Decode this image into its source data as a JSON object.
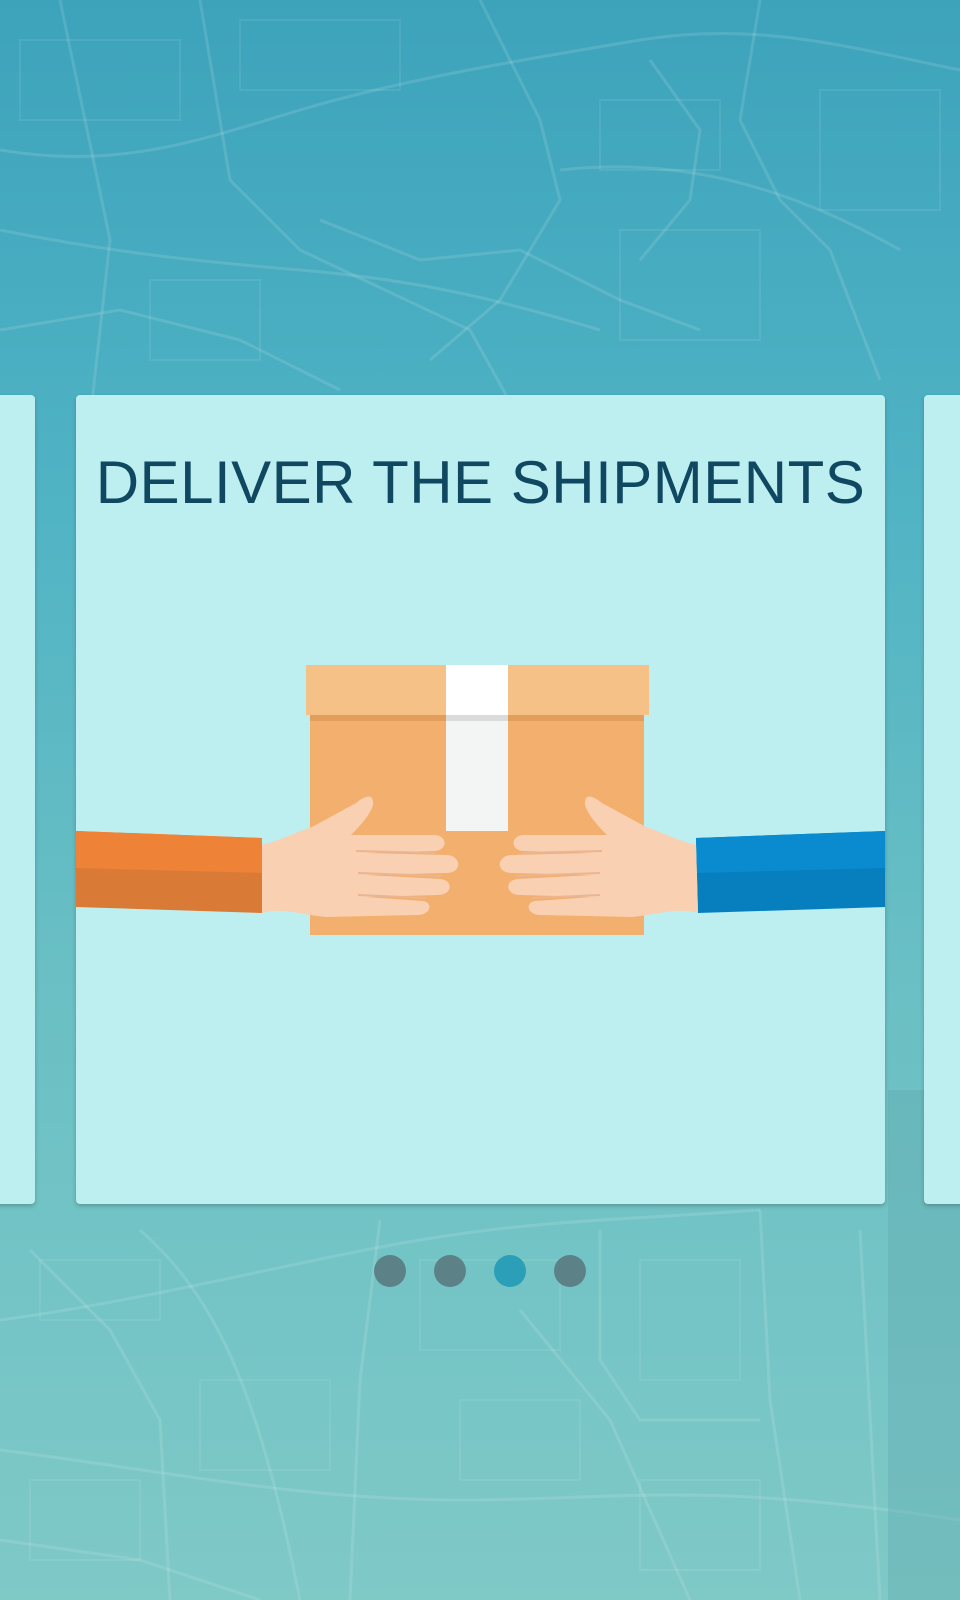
{
  "onboarding": {
    "title": "DELIVER THE SHIPMENTS",
    "illustration_name": "hands-passing-package",
    "pages": [
      {
        "active": false
      },
      {
        "active": false
      },
      {
        "active": true
      },
      {
        "active": false
      }
    ],
    "active_page_index": 2
  },
  "colors": {
    "background_top": "#3da3bb",
    "background_bottom": "#7fc9c7",
    "card": "#bdeef0",
    "title": "#0f4860",
    "dot_inactive": "#5c8288",
    "dot_active": "#2b9fb8",
    "box": "#f2af6d",
    "sleeve_left": "#ee8236",
    "sleeve_right": "#0a8bcf",
    "skin": "#f9d0b1"
  }
}
